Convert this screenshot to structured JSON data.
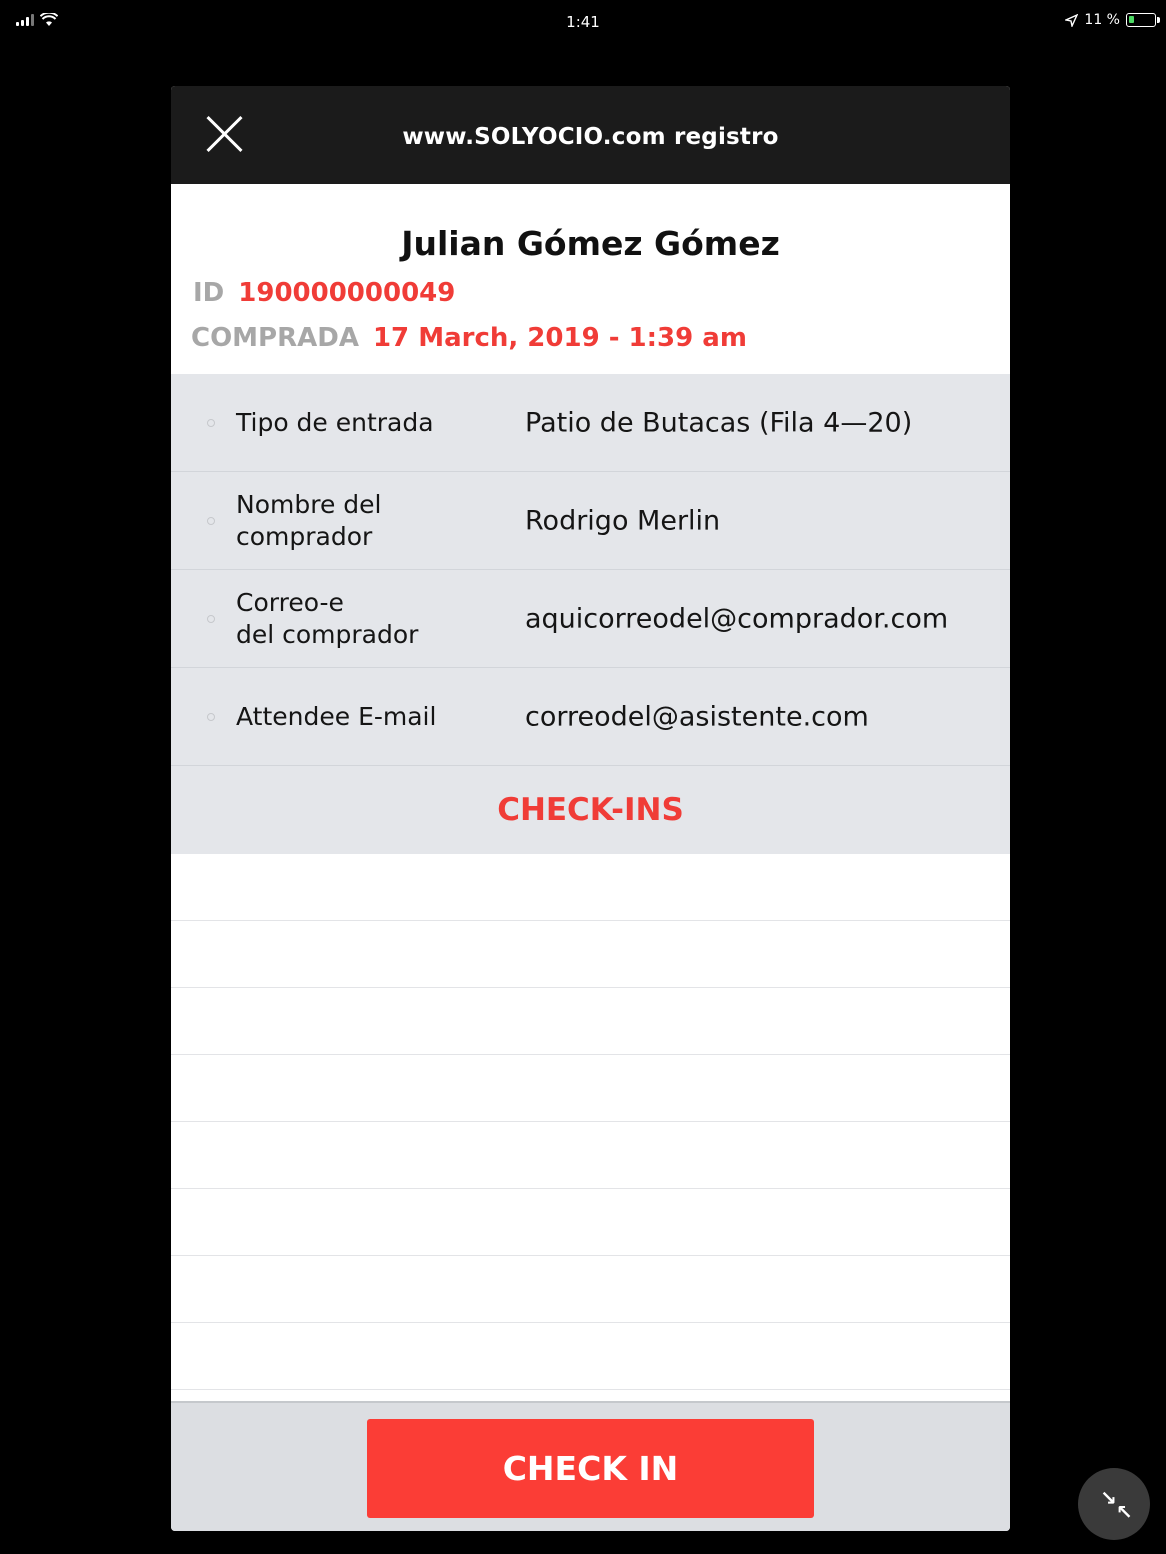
{
  "status_bar": {
    "time": "1:41",
    "battery_text": "11 %",
    "battery_level_percent": 11,
    "icons": [
      "signal-icon",
      "wifi-icon",
      "location-arrow-icon",
      "battery-icon"
    ]
  },
  "modal": {
    "title": "www.SOLYOCIO.com registro",
    "close_icon": "close-icon",
    "attendee_name": "Julian Gómez Gómez",
    "id_label": "ID",
    "id_value": "190000000049",
    "purchased_label": "COMPRADA",
    "purchased_value": "17 March, 2019 - 1:39 am",
    "details": [
      {
        "label": "Tipo de entrada",
        "value": "Patio de Butacas (Fila 4—20)"
      },
      {
        "label": "Nombre del\ncomprador",
        "value": "Rodrigo Merlin"
      },
      {
        "label": "Correo-e\ndel comprador",
        "value": "aquicorreodel@comprador.com"
      },
      {
        "label": "Attendee E-mail",
        "value": "correodel@asistente.com"
      }
    ],
    "checkins_heading": "CHECK-INS",
    "checkin_button": "CHECK IN"
  },
  "colors": {
    "accent_red": "#f03c37",
    "button_red": "#fb3d36",
    "header_bg": "#1b1b1b",
    "details_bg": "#e4e6ea",
    "label_gray": "#a7a7a7"
  },
  "floating_button": {
    "icon": "collapse-arrows-icon"
  }
}
